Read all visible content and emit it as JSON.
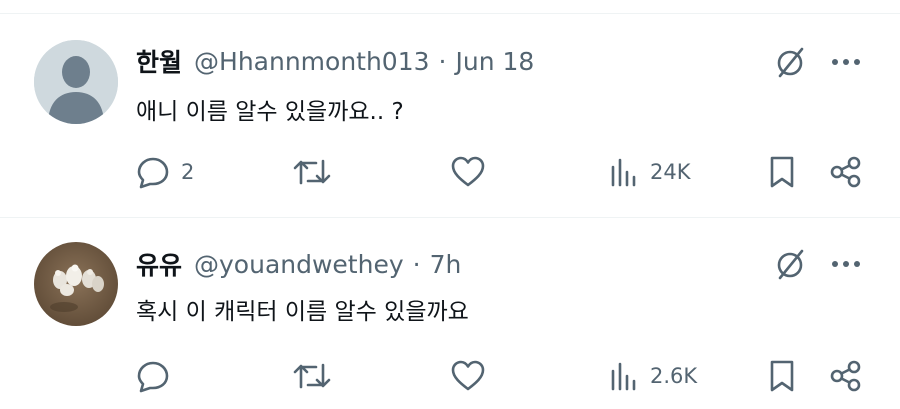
{
  "tweets": [
    {
      "name": "한월",
      "handle": "@Hhannmonth013",
      "separator": "·",
      "time": "Jun 18",
      "text": "애니 이름 알수 있을까요.. ?",
      "replies": "2",
      "retweets": "",
      "likes": "",
      "views": "24K",
      "avatar": "default-avatar"
    },
    {
      "name": "유유",
      "handle": "@youandwethey",
      "separator": "·",
      "time": "7h",
      "text": "혹시 이 캐릭터 이름 알수 있을까요",
      "replies": "",
      "retweets": "",
      "likes": "",
      "views": "2.6K",
      "avatar": "photo-avatar"
    }
  ],
  "colors": {
    "text": "#0f1419",
    "secondary": "#536471",
    "divider": "#eff3f4",
    "default_avatar_bg": "#cfd9de",
    "default_avatar_fg": "#6e7f8d"
  }
}
